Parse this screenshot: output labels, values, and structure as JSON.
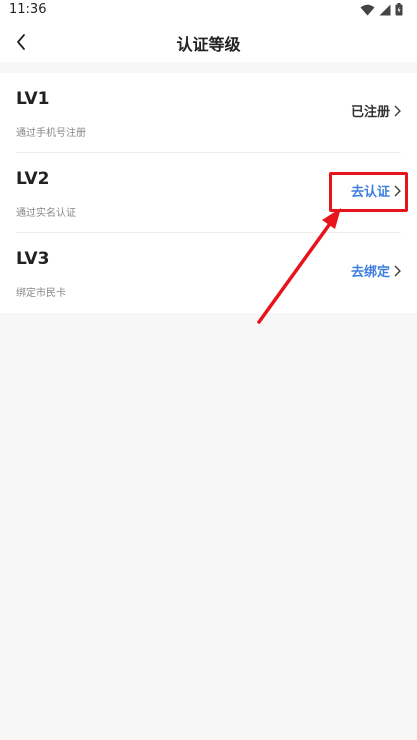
{
  "status_bar": {
    "time": "11:36",
    "icons": [
      "wifi-icon",
      "signal-icon",
      "battery-icon"
    ]
  },
  "header": {
    "title": "认证等级",
    "back_icon": "chevron-left-icon"
  },
  "levels": [
    {
      "title": "LV1",
      "desc": "通过手机号注册",
      "action": "已注册",
      "state": "done"
    },
    {
      "title": "LV2",
      "desc": "通过实名认证",
      "action": "去认证",
      "state": "link"
    },
    {
      "title": "LV3",
      "desc": "绑定市民卡",
      "action": "去绑定",
      "state": "link"
    }
  ],
  "colors": {
    "accent": "#3d7ee0",
    "annotation": "#e8141c",
    "background": "#f7f7f7"
  }
}
